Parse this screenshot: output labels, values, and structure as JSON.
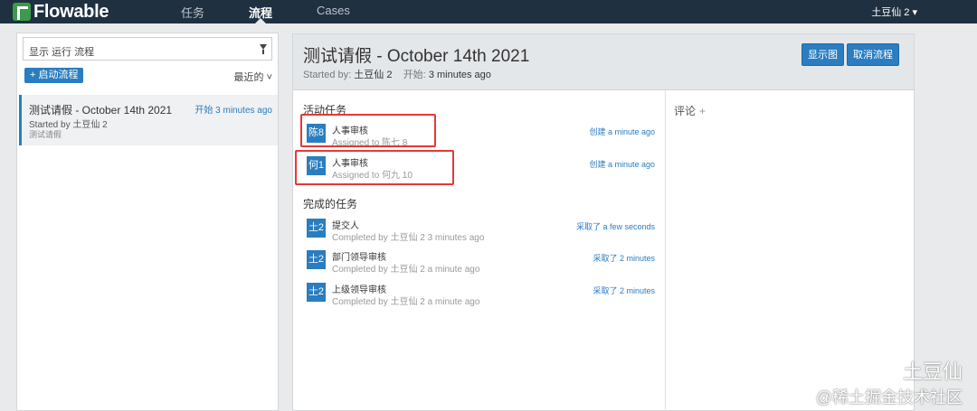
{
  "nav": {
    "brand": "Flowable",
    "items": [
      "任务",
      "流程",
      "Cases"
    ],
    "user": "土豆仙 2 ▾"
  },
  "left": {
    "filter_text": "显示 运行 流程",
    "start_button": "+ 启动流程",
    "sort_label": "最近的 ˅",
    "process_item": {
      "title": "测试请假 - October 14th 2021",
      "time": "开始 3 minutes ago",
      "started_by": "Started by 土豆仙 2",
      "definition": "测试请假"
    }
  },
  "main": {
    "title": "测试请假 - October 14th 2021",
    "started_by_label": "Started by:",
    "started_by_value": "土豆仙 2",
    "start_label": "开始:",
    "start_value": "3 minutes ago",
    "show_diagram_button": "显示图",
    "cancel_process_button": "取消流程",
    "active_tasks_title": "活动任务",
    "active_tasks": [
      {
        "badge": "陈8",
        "name": "人事审核",
        "sub": "Assigned to 陈七 8",
        "time": "创建 a minute ago"
      },
      {
        "badge": "何1",
        "name": "人事审核",
        "sub": "Assigned to 何九 10",
        "time": "创建 a minute ago"
      }
    ],
    "completed_tasks_title": "完成的任务",
    "completed_tasks": [
      {
        "badge": "土2",
        "name": "提交人",
        "sub": "Completed by 土豆仙 2 3 minutes ago",
        "time": "采取了 a few seconds"
      },
      {
        "badge": "土2",
        "name": "部门领导审核",
        "sub": "Completed by 土豆仙 2 a minute ago",
        "time": "采取了 2 minutes"
      },
      {
        "badge": "土2",
        "name": "上级领导审核",
        "sub": "Completed by 土豆仙 2 a minute ago",
        "time": "采取了 2 minutes"
      }
    ],
    "comments_label": "评论",
    "comments_add": "+"
  },
  "watermark": {
    "top": "土豆仙",
    "bottom": "@稀土掘金技术社区"
  },
  "colors": {
    "navbar": "#1f3041",
    "accent": "#2a7dc0",
    "highlight": "#e53935"
  }
}
